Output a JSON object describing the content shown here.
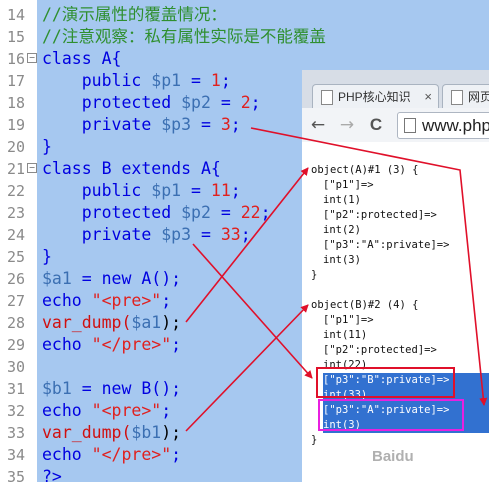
{
  "editor": {
    "lines": [
      {
        "num": "14",
        "fold": false,
        "tokens": [
          {
            "t": "//演示属性的覆盖情况：",
            "c": "comment"
          }
        ]
      },
      {
        "num": "15",
        "fold": false,
        "tokens": [
          {
            "t": "//注意观察：私有属性实际是不能覆盖",
            "c": "comment"
          }
        ]
      },
      {
        "num": "16",
        "fold": true,
        "tokens": [
          {
            "t": "class ",
            "c": "kw"
          },
          {
            "t": "A{",
            "c": "kw"
          }
        ]
      },
      {
        "num": "17",
        "fold": false,
        "tokens": [
          {
            "t": "    public ",
            "c": "kw"
          },
          {
            "t": "$p1",
            "c": "var"
          },
          {
            "t": " = ",
            "c": "kw"
          },
          {
            "t": "1",
            "c": "num"
          },
          {
            "t": ";",
            "c": "kw"
          }
        ]
      },
      {
        "num": "18",
        "fold": false,
        "tokens": [
          {
            "t": "    protected ",
            "c": "kw"
          },
          {
            "t": "$p2",
            "c": "var"
          },
          {
            "t": " = ",
            "c": "kw"
          },
          {
            "t": "2",
            "c": "num"
          },
          {
            "t": ";",
            "c": "kw"
          }
        ]
      },
      {
        "num": "19",
        "fold": false,
        "tokens": [
          {
            "t": "    private ",
            "c": "kw"
          },
          {
            "t": "$p3",
            "c": "var"
          },
          {
            "t": " = ",
            "c": "kw"
          },
          {
            "t": "3",
            "c": "num"
          },
          {
            "t": ";",
            "c": "kw"
          }
        ]
      },
      {
        "num": "20",
        "fold": false,
        "tokens": [
          {
            "t": "}",
            "c": "kw"
          }
        ]
      },
      {
        "num": "21",
        "fold": true,
        "tokens": [
          {
            "t": "class B extends A{",
            "c": "kw"
          }
        ]
      },
      {
        "num": "22",
        "fold": false,
        "tokens": [
          {
            "t": "    public ",
            "c": "kw"
          },
          {
            "t": "$p1",
            "c": "var"
          },
          {
            "t": " = ",
            "c": "kw"
          },
          {
            "t": "11",
            "c": "num"
          },
          {
            "t": ";",
            "c": "kw"
          }
        ]
      },
      {
        "num": "23",
        "fold": false,
        "tokens": [
          {
            "t": "    protected ",
            "c": "kw"
          },
          {
            "t": "$p2",
            "c": "var"
          },
          {
            "t": " = ",
            "c": "kw"
          },
          {
            "t": "22",
            "c": "num"
          },
          {
            "t": ";",
            "c": "kw"
          }
        ]
      },
      {
        "num": "24",
        "fold": false,
        "tokens": [
          {
            "t": "    private ",
            "c": "kw"
          },
          {
            "t": "$p3",
            "c": "var"
          },
          {
            "t": " = ",
            "c": "kw"
          },
          {
            "t": "33",
            "c": "num"
          },
          {
            "t": ";",
            "c": "kw"
          }
        ]
      },
      {
        "num": "25",
        "fold": false,
        "tokens": [
          {
            "t": "}",
            "c": "kw"
          }
        ]
      },
      {
        "num": "26",
        "fold": false,
        "tokens": [
          {
            "t": "$a1",
            "c": "var"
          },
          {
            "t": " = new ",
            "c": "kw"
          },
          {
            "t": "A",
            "c": "kw"
          },
          {
            "t": "();",
            "c": "kw"
          }
        ]
      },
      {
        "num": "27",
        "fold": false,
        "tokens": [
          {
            "t": "echo ",
            "c": "kw"
          },
          {
            "t": "\"<pre>\"",
            "c": "str"
          },
          {
            "t": ";",
            "c": "kw"
          }
        ]
      },
      {
        "num": "28",
        "fold": false,
        "tokens": [
          {
            "t": "var_dump(",
            "c": "red"
          },
          {
            "t": "$a1",
            "c": "var"
          },
          {
            "t": ");",
            "c": "black"
          }
        ]
      },
      {
        "num": "29",
        "fold": false,
        "tokens": [
          {
            "t": "echo ",
            "c": "kw"
          },
          {
            "t": "\"</pre>\"",
            "c": "str"
          },
          {
            "t": ";",
            "c": "kw"
          }
        ]
      },
      {
        "num": "30",
        "fold": false,
        "tokens": []
      },
      {
        "num": "31",
        "fold": false,
        "tokens": [
          {
            "t": "$b1",
            "c": "var"
          },
          {
            "t": " = new ",
            "c": "kw"
          },
          {
            "t": "B",
            "c": "kw"
          },
          {
            "t": "();",
            "c": "kw"
          }
        ]
      },
      {
        "num": "32",
        "fold": false,
        "tokens": [
          {
            "t": "echo ",
            "c": "kw"
          },
          {
            "t": "\"<pre>\"",
            "c": "str"
          },
          {
            "t": ";",
            "c": "kw"
          }
        ]
      },
      {
        "num": "33",
        "fold": false,
        "tokens": [
          {
            "t": "var_dump(",
            "c": "red"
          },
          {
            "t": "$b1",
            "c": "var"
          },
          {
            "t": ");",
            "c": "black"
          }
        ]
      },
      {
        "num": "34",
        "fold": false,
        "tokens": [
          {
            "t": "echo ",
            "c": "kw"
          },
          {
            "t": "\"</pre>\"",
            "c": "str"
          },
          {
            "t": ";",
            "c": "kw"
          }
        ]
      },
      {
        "num": "35",
        "fold": false,
        "tokens": [
          {
            "t": "?>",
            "c": "kw"
          }
        ]
      }
    ]
  },
  "browser": {
    "tabs": [
      {
        "label": "PHP核心知识",
        "close": "×"
      },
      {
        "label": "网页"
      }
    ],
    "nav": {
      "back": "←",
      "forward": "→",
      "reload": "C"
    },
    "url": "www.php",
    "output": [
      {
        "text": "object(A)#1 (3) {",
        "indent": 0,
        "sel": false
      },
      {
        "text": "[\"p1\"]=>",
        "indent": 1,
        "sel": false
      },
      {
        "text": "int(1)",
        "indent": 1,
        "sel": false
      },
      {
        "text": "[\"p2\":protected]=>",
        "indent": 1,
        "sel": false
      },
      {
        "text": "int(2)",
        "indent": 1,
        "sel": false
      },
      {
        "text": "[\"p3\":\"A\":private]=>",
        "indent": 1,
        "sel": false
      },
      {
        "text": "int(3)",
        "indent": 1,
        "sel": false
      },
      {
        "text": "}",
        "indent": 0,
        "sel": false
      },
      {
        "text": "",
        "indent": 0,
        "sel": false
      },
      {
        "text": "object(B)#2 (4) {",
        "indent": 0,
        "sel": false
      },
      {
        "text": "[\"p1\"]=>",
        "indent": 1,
        "sel": false
      },
      {
        "text": "int(11)",
        "indent": 1,
        "sel": false
      },
      {
        "text": "[\"p2\":protected]=>",
        "indent": 1,
        "sel": false
      },
      {
        "text": "int(22)",
        "indent": 1,
        "sel": false
      },
      {
        "text": "[\"p3\":\"B\":private]=>",
        "indent": 1,
        "sel": true
      },
      {
        "text": "int(33)",
        "indent": 1,
        "sel": true
      },
      {
        "text": "[\"p3\":\"A\":private]=>",
        "indent": 1,
        "sel": true
      },
      {
        "text": "int(3)",
        "indent": 1,
        "sel": true
      },
      {
        "text": "}",
        "indent": 0,
        "sel": false
      }
    ]
  },
  "colors": {
    "arrow": "#e0102a",
    "highlight_red": "#e0102a",
    "highlight_magenta": "#e820e0",
    "selection": "#3271d0",
    "editor_bg": "#a6c8f0"
  },
  "watermark": "Baidu"
}
